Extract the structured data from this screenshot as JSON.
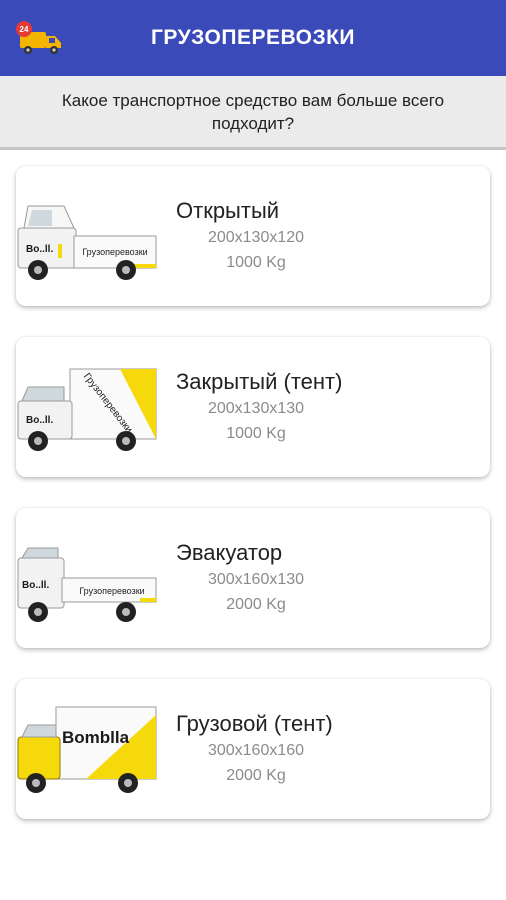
{
  "appbar": {
    "title": "ГРУЗОПЕРЕВОЗКИ",
    "logo_icon": "delivery-truck-icon",
    "logo_badge": "24",
    "color": "#3a4ab8"
  },
  "question": "Какое транспортное средство вам больше всего подходит?",
  "brand_colors": {
    "yellow": "#f5d90a",
    "dark": "#1a1a1a"
  },
  "vehicles": [
    {
      "name": "Открытый",
      "dimensions": "200x130x120",
      "capacity": "1000 Kg",
      "image_icon": "open-pickup-truck-icon",
      "truck_text": "Грузоперевозки",
      "brand": "Bo..ll."
    },
    {
      "name": "Закрытый (тент)",
      "dimensions": "200x130x130",
      "capacity": "1000 Kg",
      "image_icon": "covered-tent-truck-icon",
      "truck_text": "Грузоперевозки",
      "brand": "Bo..ll."
    },
    {
      "name": "Эвакуатор",
      "dimensions": "300x160x130",
      "capacity": "2000 Kg",
      "image_icon": "tow-truck-icon",
      "truck_text": "Грузоперевозки",
      "brand": "Bo..ll."
    },
    {
      "name": "Грузовой (тент)",
      "dimensions": "300x160x160",
      "capacity": "2000 Kg",
      "image_icon": "cargo-tent-truck-icon",
      "truck_text": "",
      "brand": "Bomblla"
    }
  ]
}
